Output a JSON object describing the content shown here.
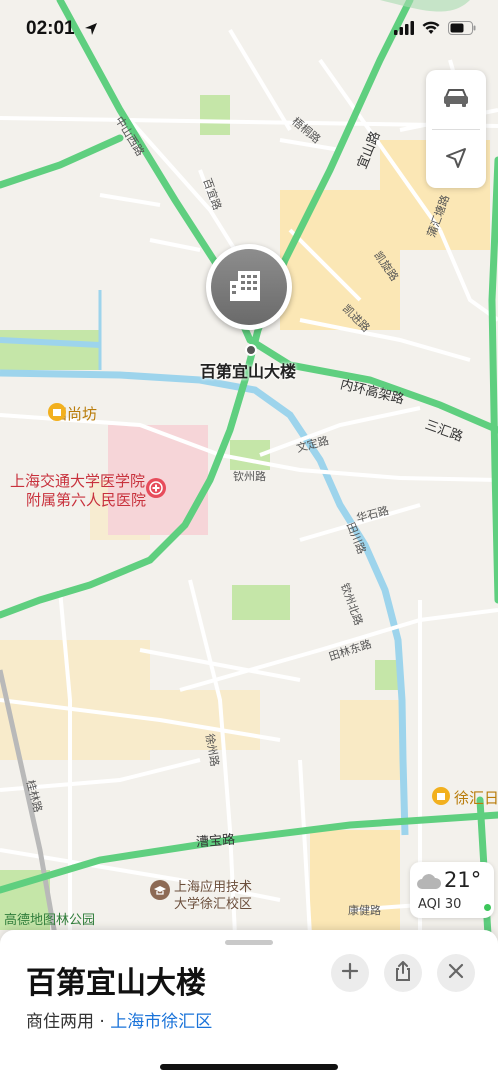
{
  "status": {
    "time": "02:01"
  },
  "map": {
    "place_labels": {
      "tianshangfang": "田尚坊",
      "hospital_line1": "上海交通大学医学院",
      "hospital_line2": "附属第六人民医院",
      "university_line1": "上海应用技术",
      "university_line2": "大学徐汇校区",
      "xuhui": "徐汇日",
      "park": "高德地图林公园"
    },
    "road_labels": {
      "zhongshan_west": "中山西路",
      "neihuan": "内环高架路",
      "sanhui": "三汇路",
      "qinzhou": "钦州路",
      "wending": "文定路",
      "huashi": "华石路",
      "tianchuan": "田川路",
      "qinzhou_north": "钦州北路",
      "tianlin_east": "田林东路",
      "caobao": "漕宝路",
      "guilin": "桂林路",
      "kangjian": "康健路",
      "yishan": "宜山路",
      "xuzhou": "徐州路",
      "kaixuan": "凯旋路",
      "kaijin": "凯进路",
      "puhui": "蒲汇塘路",
      "baicheng": "百宜路",
      "guiyuan": "梧桐路"
    }
  },
  "pin": {
    "label": "百第宜山大楼",
    "icon": "building-icon"
  },
  "weather": {
    "temp": "21°",
    "aqi": "AQI 30",
    "icon": "cloud-icon",
    "aqi_color": "#3cc65a"
  },
  "sheet": {
    "title": "百第宜山大楼",
    "category": "商住两用",
    "separator": " · ",
    "location": "上海市徐汇区"
  },
  "colors": {
    "highway": "#5fcf7f",
    "water": "#9dd4ec",
    "park": "#c5e6a8",
    "urban": "#fbe7b5",
    "link": "#1a73d9"
  }
}
